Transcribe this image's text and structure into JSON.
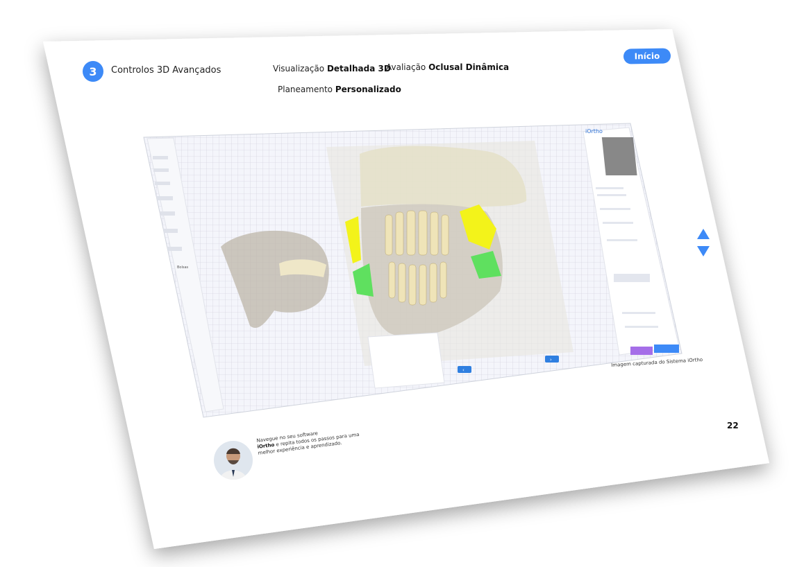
{
  "slide": {
    "step_number": "3",
    "step_title": "Controlos 3D Avançados",
    "home_button": "Início",
    "page_number": "22",
    "caption": "Imagem capturada do Sistema iOrtho"
  },
  "features": [
    {
      "prefix": "Visualização",
      "bold": "Detalhada 3D"
    },
    {
      "prefix": "Avaliação",
      "bold": "Oclusal Dinâmica"
    },
    {
      "prefix": "Planeamento",
      "bold": "Personalizado"
    }
  ],
  "note": {
    "line1": "Navegue no seu software",
    "brand": "iOrtho",
    "line2": " e repita todos os passos para uma",
    "line3": "melhor experiência e aprendizado."
  },
  "app": {
    "brand": "iOrtho",
    "sidebar_item": "Bolsas"
  },
  "colors": {
    "accent": "#3d8af7",
    "yellow_attachment": "#f3f31a",
    "green_attachment": "#5fe05f"
  },
  "icons": [
    "chevron-up-icon",
    "chevron-down-icon",
    "chevron-left-icon",
    "chevron-right-icon"
  ]
}
